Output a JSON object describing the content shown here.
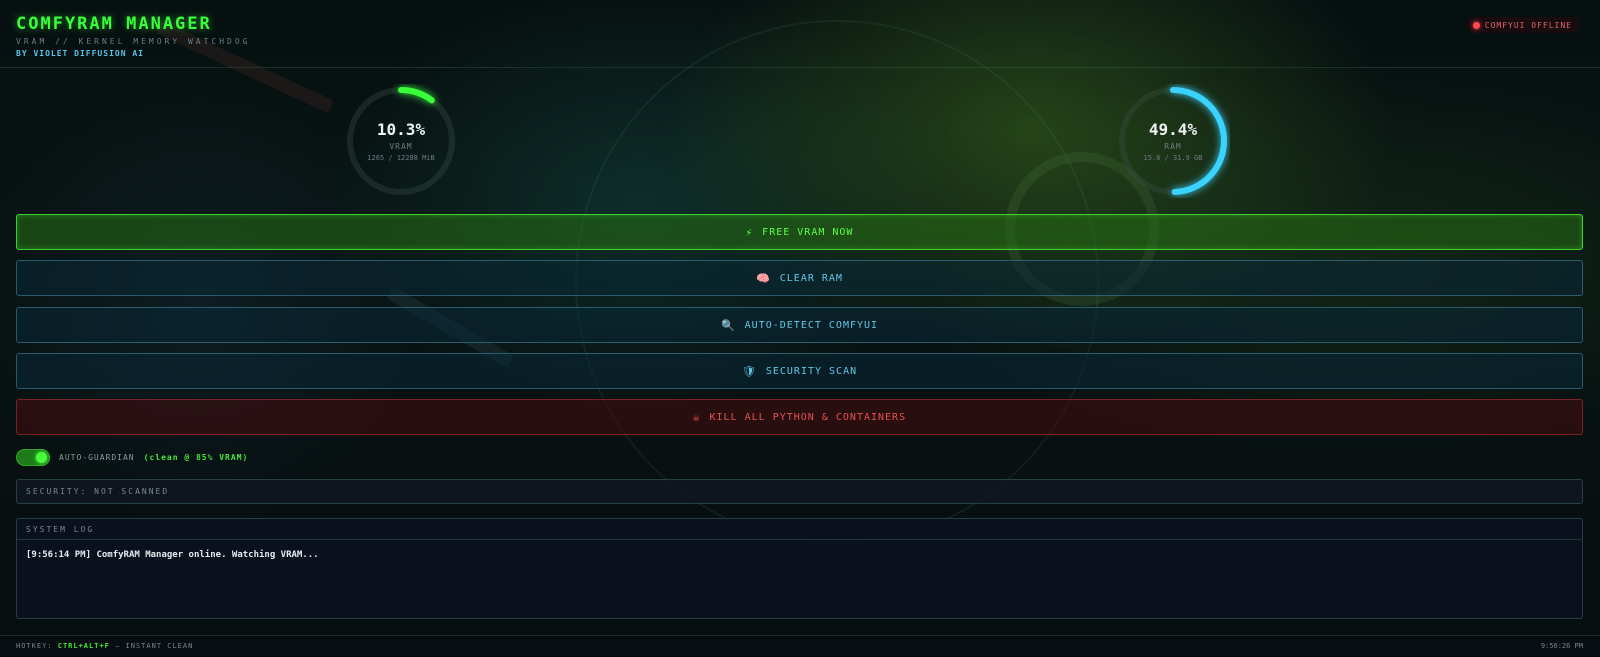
{
  "header": {
    "title": "COMFYRAM MANAGER",
    "subtitle": "VRAM // KERNEL MEMORY WATCHDOG",
    "byline": "BY VIOLET DIFFUSION AI",
    "status_text": "COMFYUI OFFLINE",
    "status_color": "#ff4a50"
  },
  "gauges": {
    "vram": {
      "percent_text": "10.3%",
      "percent": 10.3,
      "label": "VRAM",
      "detail": "1265 / 12288 MiB",
      "color": "#39ff3a"
    },
    "ram": {
      "percent_text": "49.4%",
      "percent": 49.4,
      "label": "RAM",
      "detail": "15.8 / 31.9 GB",
      "color": "#3ad2ff"
    }
  },
  "actions": {
    "free_vram": {
      "icon": "⚡",
      "icon_name": "lightning-icon",
      "label": "FREE VRAM NOW"
    },
    "clear_ram": {
      "icon": "🧠",
      "icon_name": "brain-icon",
      "label": "CLEAR RAM"
    },
    "auto_detect": {
      "icon": "🔍",
      "icon_name": "magnifier-icon",
      "label": "AUTO-DETECT COMFYUI"
    },
    "security_scan": {
      "icon": "🛡",
      "icon_name": "shield-icon",
      "label": "SECURITY SCAN"
    },
    "kill_all": {
      "icon": "☠",
      "icon_name": "skull-icon",
      "label": "KILL ALL PYTHON & CONTAINERS"
    }
  },
  "guardian": {
    "enabled": true,
    "label": "AUTO-GUARDIAN",
    "note": "(clean @ 85% VRAM)"
  },
  "security": {
    "status_text": "SECURITY: NOT SCANNED"
  },
  "log": {
    "header": "SYSTEM LOG",
    "entries": [
      "[9:56:14 PM] ComfyRAM Manager online. Watching VRAM..."
    ]
  },
  "footer": {
    "hotkey_prefix": "HOTKEY:",
    "hotkey_keys": "CTRL+ALT+F",
    "hotkey_suffix": "— INSTANT CLEAN",
    "clock": "9:56:26 PM"
  }
}
